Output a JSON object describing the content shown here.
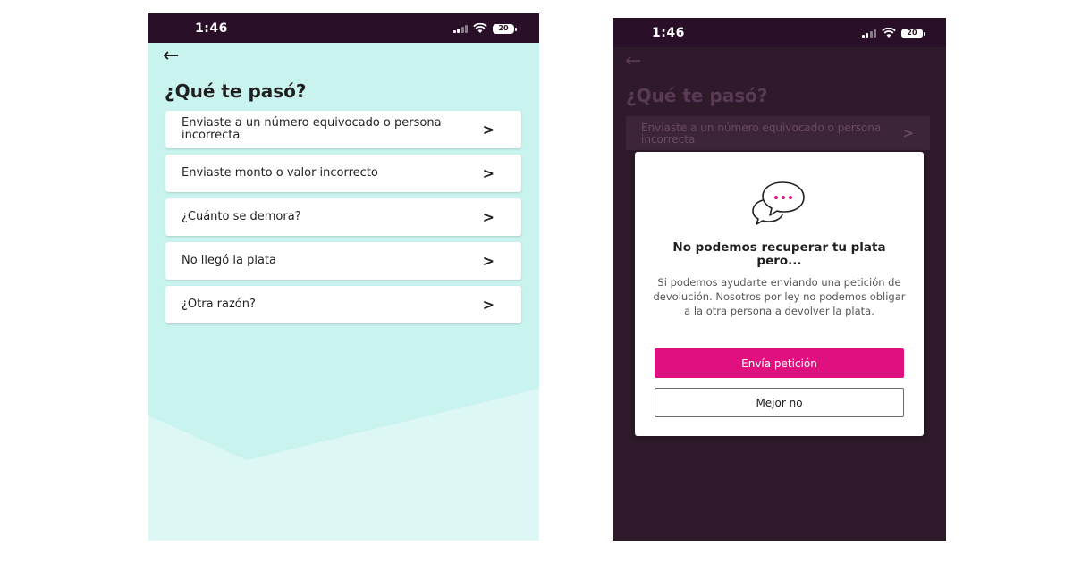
{
  "status": {
    "time": "1:46",
    "battery": "20",
    "battery_right": "20"
  },
  "left_screen": {
    "title": "¿Qué te pasó?",
    "options": [
      {
        "label": "Enviaste a un número equivocado o persona incorrecta"
      },
      {
        "label": "Enviaste monto o valor incorrecto"
      },
      {
        "label": "¿Cuánto se demora?"
      },
      {
        "label": "No llegó la plata"
      },
      {
        "label": "¿Otra razón?"
      }
    ]
  },
  "right_screen": {
    "title": "¿Qué te pasó?",
    "first_option": "Enviaste a un número equivocado o persona incorrecta",
    "modal": {
      "title": "No podemos recuperar tu plata pero...",
      "body": "Si podemos ayudarte enviando una petición de devolución. Nosotros por ley no podemos obligar a la otra persona a devolver la plata.",
      "primary_button": "Envía petición",
      "secondary_button": "Mejor no"
    }
  },
  "icons": {
    "back": "arrow-left-icon",
    "chevron": "chevron-right-icon",
    "chat": "chat-bubbles-icon"
  },
  "colors": {
    "status_bar": "#2a0f28",
    "left_background": "#c9f3ef",
    "overlay_background": "#2e1a2b",
    "accent": "#e0107f"
  }
}
